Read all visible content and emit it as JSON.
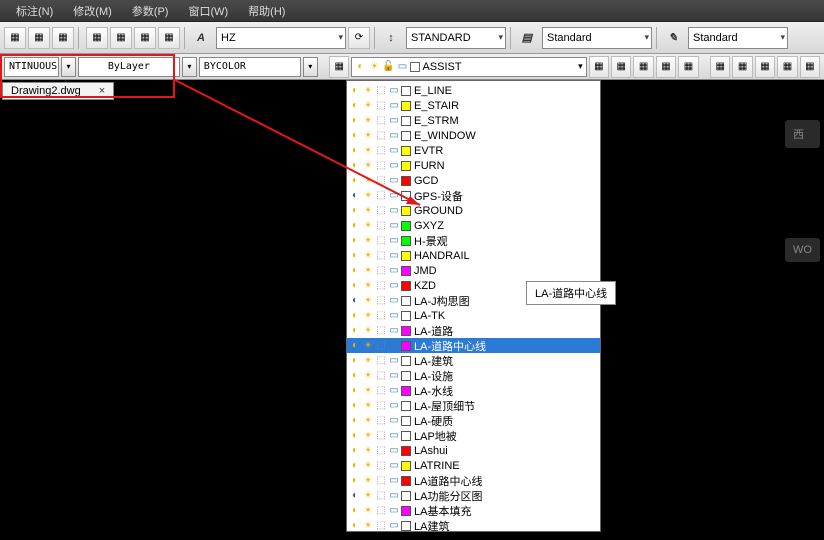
{
  "menu": {
    "items": [
      "标注(N)",
      "修改(M)",
      "参数(P)",
      "窗口(W)",
      "帮助(H)"
    ]
  },
  "toolbar": {
    "style_combo1": "HZ",
    "style_combo2": "STANDARD",
    "style_combo3": "Standard",
    "style_combo4": "Standard"
  },
  "toolbar2": {
    "linetype": "NTINUOUS",
    "bylayer": "ByLayer",
    "bycolor": "BYCOLOR",
    "layer_header": "ASSIST",
    "layer_header_swatch": "#ffffff"
  },
  "doc": {
    "name": "Drawing2.dwg",
    "close": "×"
  },
  "tooltip": "LA-道路中心线",
  "side": {
    "w": "西",
    "wo": "WO"
  },
  "layers": [
    {
      "name": "E_LINE",
      "color": "#ffffff",
      "on": true
    },
    {
      "name": "E_STAIR",
      "color": "#ffff00",
      "on": true
    },
    {
      "name": "E_STRM",
      "color": "#ffffff",
      "on": true
    },
    {
      "name": "E_WINDOW",
      "color": "#ffffff",
      "on": true
    },
    {
      "name": "EVTR",
      "color": "#ffff00",
      "on": true
    },
    {
      "name": "FURN",
      "color": "#ffff00",
      "on": true
    },
    {
      "name": "GCD",
      "color": "#ff0000",
      "on": true
    },
    {
      "name": "GPS-设备",
      "color": "#ffffff",
      "on": false
    },
    {
      "name": "GROUND",
      "color": "#ffff00",
      "on": true
    },
    {
      "name": "GXYZ",
      "color": "#00ff00",
      "on": true
    },
    {
      "name": "H-景观",
      "color": "#00ff00",
      "on": true
    },
    {
      "name": "HANDRAIL",
      "color": "#ffff00",
      "on": true
    },
    {
      "name": "JMD",
      "color": "#ff00ff",
      "on": true
    },
    {
      "name": "KZD",
      "color": "#ff0000",
      "on": true
    },
    {
      "name": "LA-J构思图",
      "color": "#ffffff",
      "on": false
    },
    {
      "name": "LA-TK",
      "color": "#ffffff",
      "on": true
    },
    {
      "name": "LA-道路",
      "color": "#ff00ff",
      "on": true
    },
    {
      "name": "LA-道路中心线",
      "color": "#ff00ff",
      "on": true,
      "selected": true
    },
    {
      "name": "LA-建筑",
      "color": "#ffffff",
      "on": true
    },
    {
      "name": "LA-设施",
      "color": "#ffffff",
      "on": true
    },
    {
      "name": "LA-水线",
      "color": "#ff00ff",
      "on": true
    },
    {
      "name": "LA-屋顶细节",
      "color": "#ffffff",
      "on": true
    },
    {
      "name": "LA-硬质",
      "color": "#ffffff",
      "on": true
    },
    {
      "name": "LAP地被",
      "color": "#ffffff",
      "on": true
    },
    {
      "name": "LAshui",
      "color": "#ff0000",
      "on": true
    },
    {
      "name": "LATRINE",
      "color": "#ffff00",
      "on": true
    },
    {
      "name": "LA道路中心线",
      "color": "#ff0000",
      "on": true
    },
    {
      "name": "LA功能分区图",
      "color": "#ffffff",
      "on": false
    },
    {
      "name": "LA基本填充",
      "color": "#ff00ff",
      "on": true
    },
    {
      "name": "LA建筑",
      "color": "#ffffff",
      "on": true
    }
  ]
}
